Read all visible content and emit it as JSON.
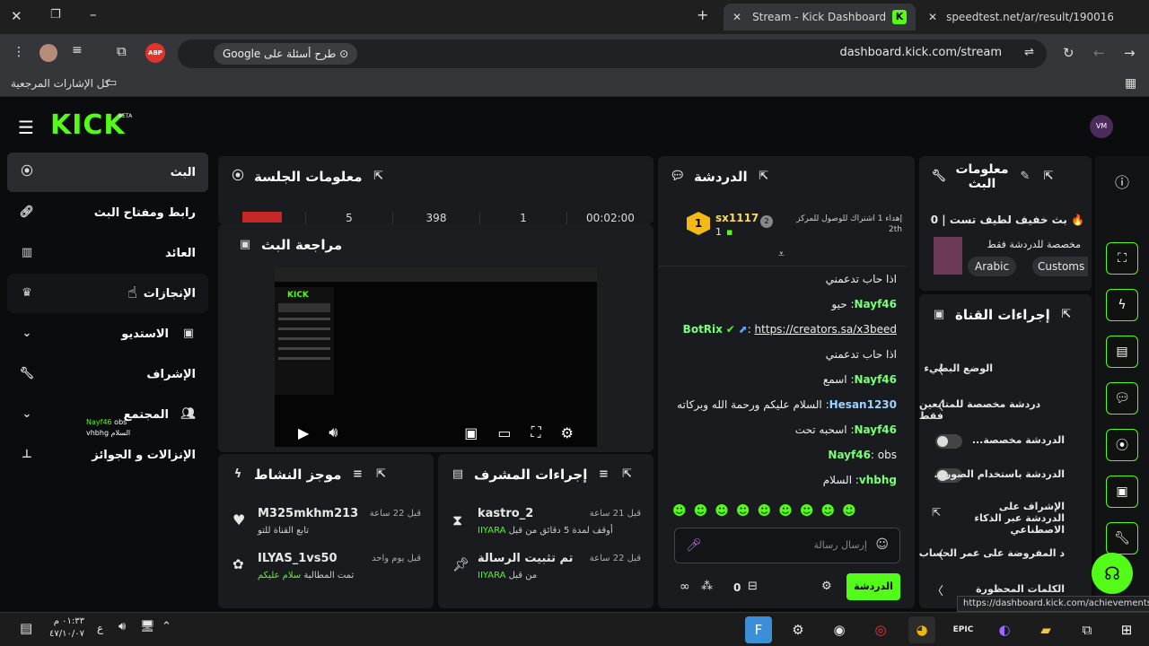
{
  "browser": {
    "tabs": [
      {
        "title": "Stream - Kick Dashboard"
      },
      {
        "title": "speedtest.net/ar/result/190016"
      }
    ],
    "url": "dashboard.kick.com/stream",
    "google_chip": "طرح أسئلة على Google",
    "abp_label": "ABP",
    "bookmarks_label": "كل الإشارات المرجعية",
    "status_url": "https://dashboard.kick.com/achievements"
  },
  "kick": {
    "logo": "KICK",
    "beta": "BETA",
    "avatar_label": "VM",
    "nav": [
      {
        "label": "البث",
        "icon": "live-icon"
      },
      {
        "label": "رابط ومفتاح البث",
        "icon": "link-icon"
      },
      {
        "label": "العائد",
        "icon": "chart-icon"
      },
      {
        "label": "الإنجازات",
        "icon": "trophy-icon"
      },
      {
        "label": "الاستديو",
        "icon": "studio-icon"
      },
      {
        "label": "الإشراف",
        "icon": "wrench-icon"
      },
      {
        "label": "المجتمع",
        "icon": "community-icon"
      },
      {
        "label": "الإنزالات و الجوائز",
        "icon": "drops-icon"
      }
    ],
    "nav_tooltip": {
      "user": "Nayf46",
      "msg1": "obs",
      "user2": "vhbhg",
      "msg2": "السلام"
    },
    "session": {
      "title": "معلومات الجلسة",
      "values": [
        "00:02:00",
        "1",
        "398",
        "5"
      ]
    },
    "review": {
      "title": "مراجعة البث"
    },
    "chat": {
      "title": "الدردشة",
      "top_user": "sx1117",
      "top_rank": "1",
      "top_count": "1",
      "gift_text": "إهداء 1 اشتراك للوصول للمركز",
      "gift_rank": "2th",
      "messages": [
        {
          "user": "",
          "text": "اذا حاب تدعمني"
        },
        {
          "user": "Nayf46",
          "text": "حيو"
        },
        {
          "user": "BotRix",
          "text": "https://creators.sa/x3beed"
        },
        {
          "user": "",
          "text": "اذا حاب تدعمني"
        },
        {
          "user": "Nayf46",
          "text": "اسمع"
        },
        {
          "user": "Hesan1230",
          "text": "السلام عليكم ورحمة الله وبركاته"
        },
        {
          "user": "Nayf46",
          "text": "اسحبه تحت"
        },
        {
          "user": "Nayf46",
          "text": "obs"
        },
        {
          "user": "vhbhg",
          "text": "السلام"
        }
      ],
      "input_placeholder": "إرسال رسالة",
      "send_label": "الدردشة",
      "viewers": "0"
    },
    "stream_info": {
      "title": "معلومات البث",
      "stream_title": "🔥 بث خفيف لطيف تست | 300 ⏳",
      "subtitle": "مخصصة للدردشة فقط",
      "tags": [
        "Arabic",
        "Customs"
      ]
    },
    "channel_actions": {
      "title": "إجراءات القناة",
      "items": [
        {
          "label": "الوضع البطيء",
          "type": "chevron"
        },
        {
          "label": "دردشة مخصصة للمتابعين فقط",
          "type": "chevron"
        },
        {
          "label": "...الدردشة مخصصة",
          "type": "toggle"
        },
        {
          "label": "...الدردشة باستخدام الصور",
          "type": "toggle"
        },
        {
          "label": "الإشراف على الدردشة عبر الذكاء الاصطناعي",
          "type": "link"
        },
        {
          "label": "...د المفروضة على عمر الحساب",
          "type": "chevron"
        },
        {
          "label": "الكلمات المحظورة",
          "type": "chevron"
        }
      ]
    },
    "activity": {
      "title": "موجز النشاط",
      "items": [
        {
          "user": "M325mkhm213",
          "time": "قبل 22 ساعة",
          "desc": "تابع القناة للتو"
        },
        {
          "user": "ILYAS_1vs50",
          "time": "قبل يوم واحد",
          "desc": "تمت المطالبة",
          "highlight": "سلام عليكم"
        }
      ]
    },
    "mod_actions": {
      "title": "إجراءات المشرف",
      "items": [
        {
          "title": "kastro_2",
          "time": "قبل 21 ساعة",
          "desc": "أوقف لمدة 5 دقائق من قبل",
          "by": "IIYARA"
        },
        {
          "title": "تم تثبيت الرسالة",
          "time": "قبل 22 ساعة",
          "desc": "من قبل",
          "by": "IIYARA"
        }
      ]
    }
  },
  "taskbar": {
    "time": "٠١:٣٣ م",
    "date": "٤٧/١٠/٠٧",
    "lang": "ع"
  },
  "colors": {
    "accent": "#53fc18",
    "panel": "#191b1f",
    "bg": "#0b0c0d"
  }
}
